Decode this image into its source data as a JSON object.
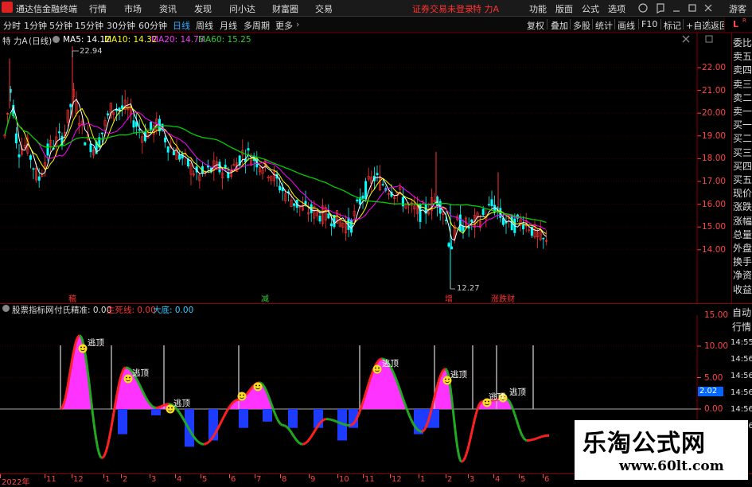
{
  "topbar": {
    "app_title": "通达信金融终端",
    "menus": [
      "行情",
      "市场",
      "资讯",
      "发现",
      "问小达",
      "财富圈",
      "交易"
    ],
    "warning": "证券交易未登录",
    "stock_title": "特 力A",
    "right_menus": [
      "功能",
      "版面",
      "公式",
      "选项"
    ],
    "guest": "游客"
  },
  "periodbar": {
    "periods": [
      "分时",
      "1分钟",
      "5分钟",
      "15分钟",
      "30分钟",
      "60分钟",
      "日线",
      "周线",
      "月线",
      "多周期",
      "更多"
    ],
    "active": "日线",
    "tools": [
      "复权",
      "叠加",
      "多股",
      "统计",
      "画线",
      "F10",
      "标记",
      "+自选",
      "返回"
    ]
  },
  "main_info": {
    "stock": "特 力A",
    "period": "(日线)",
    "ma5": "MA5: 14.12",
    "ma10": "MA10: 14.32",
    "ma20": "MA20: 14.73",
    "ma60": "MA60: 15.25"
  },
  "price_axis": [
    "22.00",
    "21.00",
    "20.00",
    "19.00",
    "18.00",
    "17.00",
    "16.00",
    "15.00",
    "14.00"
  ],
  "annotations": {
    "high": "22.94",
    "low": "12.27",
    "marks": [
      "稿",
      "减",
      "增",
      "涨跌财"
    ]
  },
  "right_panel": [
    "委比",
    "卖五",
    "卖四",
    "卖三",
    "卖二",
    "卖一",
    "买一",
    "买二",
    "买三",
    "买四",
    "买五",
    "现价",
    "涨跌",
    "涨幅",
    "总量",
    "外盘",
    "换手",
    "净资",
    "收益"
  ],
  "right_panel_bottom": [
    "自动",
    "行情"
  ],
  "indicator": {
    "name": "股票指标网",
    "l1": "付氏精准: 0.00",
    "l2": "主死线: 0.00",
    "l3": "大底: 0.00",
    "axis": [
      "15.00",
      "10.00",
      "5.00",
      "0.00"
    ],
    "current": "2.02",
    "tags": [
      "逃顶",
      "逃顶",
      "逃顶",
      "逃顶",
      "逃顶",
      "逃顶",
      "逃顶"
    ]
  },
  "time_axis": [
    "14:55",
    "14:56",
    "14:56",
    "14:56",
    "14:56",
    "14:56"
  ],
  "xaxis": [
    "2022年",
    "11",
    "12",
    "1",
    "2",
    "3",
    "4",
    "5",
    "6",
    "7",
    "8",
    "9",
    "10",
    "11",
    "12",
    "1",
    "2",
    "3",
    "4",
    "5",
    "6"
  ],
  "watermark": {
    "title": "乐淘公式网",
    "url": "www.60lt.com"
  },
  "colors": {
    "up": "#ff3333",
    "down": "#00ffff",
    "ma5": "#ffffff",
    "ma10": "#ffff00",
    "ma20": "#ff00ff",
    "ma60": "#00cc00",
    "magenta_fill": "#ff33ff",
    "blue_fill": "#1e3cff",
    "green_line": "#22aa22"
  }
}
